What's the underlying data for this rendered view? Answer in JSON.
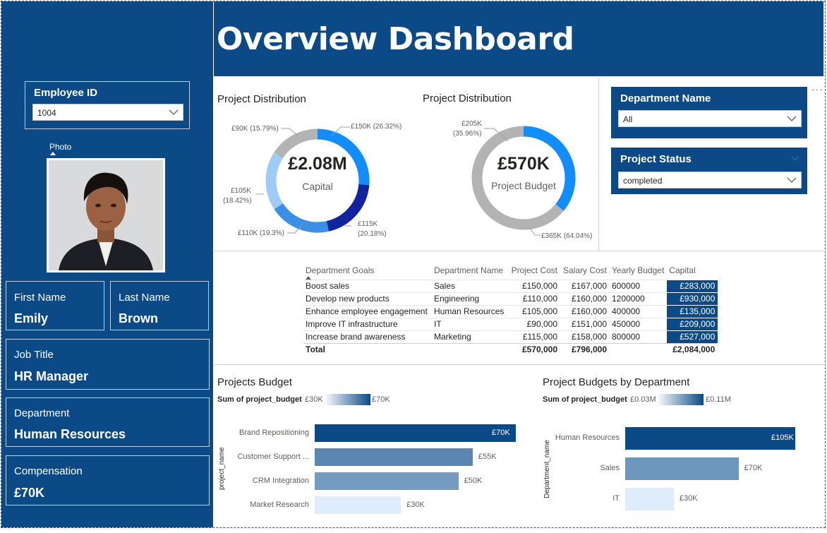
{
  "header": {
    "title": "Overview Dashboard"
  },
  "employee_slicer": {
    "title": "Employee ID",
    "value": "1004"
  },
  "photo": {
    "label": "Photo"
  },
  "cards": {
    "first_name": {
      "label": "First Name",
      "value": "Emily"
    },
    "last_name": {
      "label": "Last Name",
      "value": "Brown"
    },
    "job_title": {
      "label": "Job Title",
      "value": "HR Manager"
    },
    "department": {
      "label": "Department",
      "value": "Human Resources"
    },
    "compensation": {
      "label": "Compensation",
      "value": "£70K"
    }
  },
  "donut1": {
    "title": "Project Distribution",
    "center_value": "£2.08M",
    "center_label": "Capital",
    "labels": {
      "a": "£150K (26.32%)",
      "b1": "£115K",
      "b2": "(20.18%)",
      "c": "£110K (19.3%)",
      "d1": "£105K",
      "d2": "(18.42%)",
      "e": "£90K (15.79%)"
    }
  },
  "donut2": {
    "title": "Project Distribution",
    "center_value": "£570K",
    "center_label": "Project Budget",
    "labels": {
      "a1": "£205K",
      "a2": "(35.96%)",
      "b": "£365K (64.04%)"
    }
  },
  "department_slicer": {
    "title": "Department Name",
    "value": "All"
  },
  "status_slicer": {
    "title": "Project Status",
    "value": "completed"
  },
  "more_options": "···",
  "matrix": {
    "headers": [
      "Department Goals",
      "Department Name",
      "Project Cost",
      "Salary Cost",
      "Yearly Budget",
      "Capital"
    ],
    "rows": [
      [
        "Boost sales",
        "Sales",
        "£150,000",
        "£167,000",
        "600000",
        "£283,000"
      ],
      [
        "Develop new products",
        "Engineering",
        "£110,000",
        "£160,000",
        "1200000",
        "£930,000"
      ],
      [
        "Enhance employee engagement",
        "Human Resources",
        "£105,000",
        "£160,000",
        "400000",
        "£135,000"
      ],
      [
        "Improve IT infrastructure",
        "IT",
        "£90,000",
        "£151,000",
        "450000",
        "£209,000"
      ],
      [
        "Increase brand awareness",
        "Marketing",
        "£115,000",
        "£158,000",
        "800000",
        "£527,000"
      ]
    ],
    "total": [
      "Total",
      "",
      "£570,000",
      "£796,000",
      "",
      "£2,084,000"
    ]
  },
  "bar1": {
    "title": "Projects Budget",
    "legend_field": "Sum of project_budget",
    "legend_min": "£30K",
    "legend_max": "£70K",
    "axis_title": "project_name",
    "categories": [
      "Brand Repositioning",
      "Customer Support ...",
      "CRM Integration",
      "Market Research"
    ],
    "value_labels": [
      "£70K",
      "£55K",
      "£50K",
      "£30K"
    ]
  },
  "bar2": {
    "title": "Project Budgets by Department",
    "legend_field": "Sum of project_budget",
    "legend_min": "£0.03M",
    "legend_max": "£0.11M",
    "axis_title": "Department_name",
    "categories": [
      "Human Resources",
      "Sales",
      "IT"
    ],
    "value_labels": [
      "£105K",
      "£70K",
      "£30K"
    ]
  },
  "chart_data": [
    {
      "type": "pie",
      "title": "Project Distribution",
      "center_text": "£2.08M Capital",
      "categories": [
        "",
        "",
        "",
        "",
        ""
      ],
      "values": [
        150,
        115,
        110,
        105,
        90
      ],
      "percentages": [
        26.32,
        20.18,
        19.3,
        18.42,
        15.79
      ],
      "colors": [
        "#118dff",
        "#12239e",
        "#3b8fe6",
        "#9fcbf7",
        "#b3b3b3"
      ]
    },
    {
      "type": "pie",
      "title": "Project Distribution",
      "center_text": "£570K Project Budget",
      "values": [
        205,
        365
      ],
      "percentages": [
        35.96,
        64.04
      ],
      "colors": [
        "#118dff",
        "#b3b3b3"
      ]
    },
    {
      "type": "bar",
      "orientation": "horizontal",
      "title": "Projects Budget",
      "categories": [
        "Brand Repositioning",
        "Customer Support ...",
        "CRM Integration",
        "Market Research"
      ],
      "values": [
        70,
        55,
        50,
        30
      ],
      "ylabel": "project_name",
      "value_unit": "£K"
    },
    {
      "type": "bar",
      "orientation": "horizontal",
      "title": "Project Budgets by Department",
      "categories": [
        "Human Resources",
        "Sales",
        "IT"
      ],
      "values": [
        105,
        70,
        30
      ],
      "ylabel": "Department_name",
      "value_unit": "£K"
    }
  ]
}
